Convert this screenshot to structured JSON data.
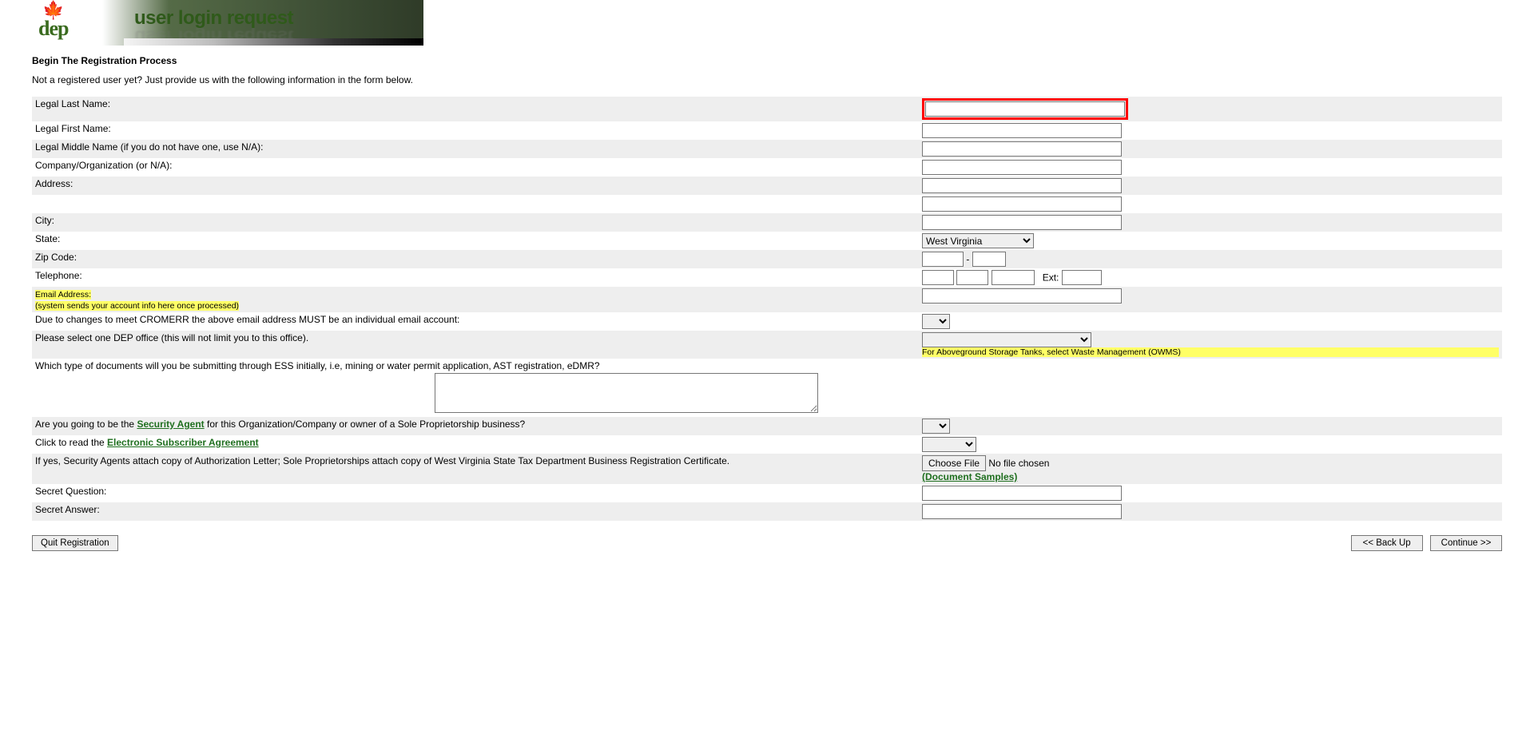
{
  "banner": {
    "logo_text": "dep",
    "title": "user login request"
  },
  "heading": "Begin The Registration Process",
  "intro": "Not a registered user yet? Just provide us with the following information in the form below.",
  "labels": {
    "last_name": "Legal Last Name:",
    "first_name": "Legal First Name:",
    "middle_name": "Legal Middle Name (if you do not have one, use N/A):",
    "company": "Company/Organization (or N/A):",
    "address": "Address:",
    "city": "City:",
    "state": "State:",
    "zip": "Zip Code:",
    "telephone": "Telephone:",
    "ext": "Ext:",
    "email": "Email Address:",
    "email_note": "(system sends your account info here once processed)",
    "cromerr": "Due to changes to meet CROMERR the above email address MUST be an individual email account:",
    "dep_office": "Please select one DEP office (this will not limit you to this office).",
    "dep_office_note": "For Aboveground Storage Tanks, select Waste Management (OWMS)",
    "doc_type": "Which type of documents will you be submitting through ESS initially, i.e, mining or water permit application, AST registration, eDMR?",
    "security_agent_pre": "Are you going to be the ",
    "security_agent_link": "Security Agent",
    "security_agent_post": " for this Organization/Company or owner of a Sole Proprietorship business?",
    "esa_pre": "Click to read the ",
    "esa_link": "Electronic Subscriber Agreement",
    "attach_note": "If yes, Security Agents attach copy of Authorization Letter; Sole Proprietorships attach copy of West Virginia State Tax Department Business Registration Certificate.",
    "choose_file": "Choose File",
    "no_file": "No file chosen",
    "doc_samples": "(Document Samples)",
    "secret_q": "Secret Question:",
    "secret_a": "Secret Answer:"
  },
  "state_selected": "West Virginia",
  "zip_sep": " - ",
  "buttons": {
    "quit": "Quit Registration",
    "back": "<< Back Up",
    "continue": "Continue >>"
  }
}
